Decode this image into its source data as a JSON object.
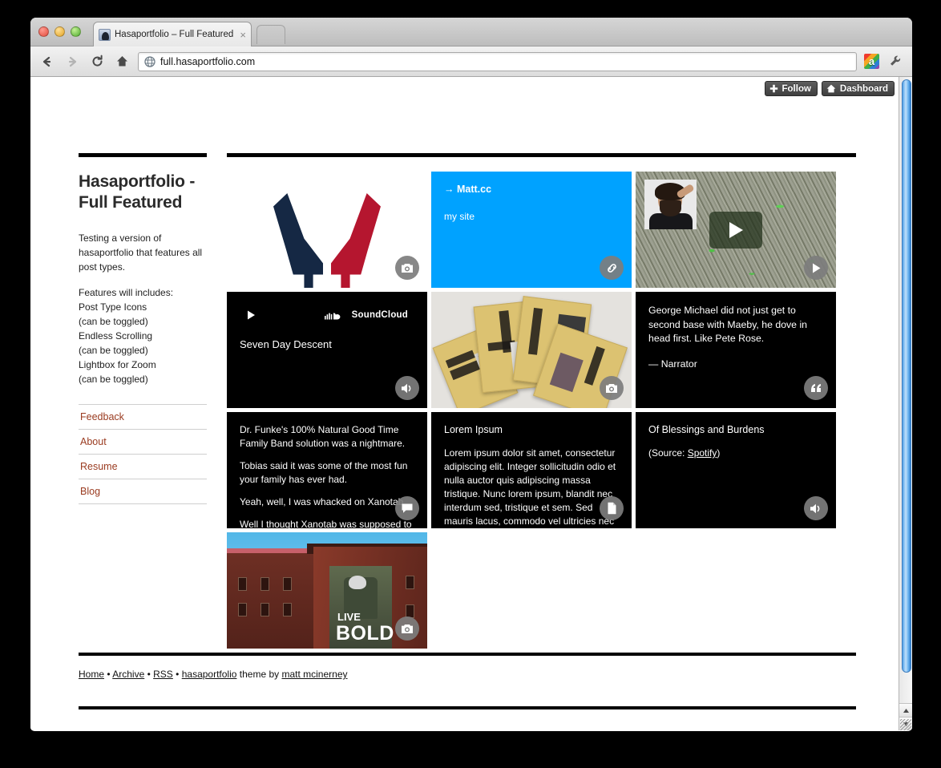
{
  "browser": {
    "tab_title": "Hasaportfolio – Full Featured",
    "tab_close": "×",
    "url": "full.hasaportfolio.com",
    "back_icon": "back-arrow-icon",
    "forward_icon": "forward-arrow-icon",
    "reload_icon": "reload-icon",
    "home_icon": "home-icon",
    "extension_icon": "rainbow-a-extension-icon",
    "menu_icon": "wrench-menu-icon"
  },
  "tumblr_bar": {
    "follow_label": "Follow",
    "dashboard_label": "Dashboard"
  },
  "sidebar": {
    "title": "Hasaportfolio - Full Featured",
    "description_1": "Testing a version of hasaportfolio that features all post types.",
    "description_2": "Features will includes:\nPost Type Icons\n(can be toggled)\nEndless Scrolling\n(can be toggled)\nLightbox for Zoom\n(can be toggled)",
    "nav": [
      {
        "label": "Feedback"
      },
      {
        "label": "About"
      },
      {
        "label": "Resume"
      },
      {
        "label": "Blog"
      }
    ]
  },
  "posts": [
    {
      "type": "photo",
      "name": "post-photo-horns",
      "badge": "camera-icon"
    },
    {
      "type": "link",
      "name": "post-link-mattcc",
      "title": "→ Matt.cc",
      "description": "my site",
      "badge": "link-icon",
      "bg": "#00a2ff"
    },
    {
      "type": "video",
      "name": "post-video",
      "badge": "play-icon"
    },
    {
      "type": "audio",
      "name": "post-audio-soundcloud",
      "service": "SoundCloud",
      "track": "Seven Day Descent",
      "badge": "speaker-icon"
    },
    {
      "type": "photo",
      "name": "post-photo-books",
      "badge": "camera-icon"
    },
    {
      "type": "quote",
      "name": "post-quote",
      "quote": "George Michael did not just get to second base with Maeby, he dove in head first. Like Pete Rose.",
      "source": "— Narrator",
      "badge": "quote-icon"
    },
    {
      "type": "chat",
      "name": "post-chat",
      "line_1": "Dr. Funke's 100% Natural Good Time Family Band solution was a nightmare.",
      "line_2": "Tobias said it was some of the most fun your family has ever had.",
      "line_3": "Yeah, well, I was whacked on Xanotab.",
      "line_4": "Well I thought Xanotab was supposed to",
      "badge": "chat-bubble-icon"
    },
    {
      "type": "text",
      "name": "post-text-lorem",
      "title": "Lorem Ipsum",
      "body": "Lorem ipsum dolor sit amet, consectetur adipiscing elit. Integer sollicitudin odio et nulla auctor quis adipiscing massa tristique. Nunc lorem ipsum, blandit nec interdum sed, tristique et sem. Sed mauris lacus, commodo vel ultricies nec",
      "badge": "document-icon"
    },
    {
      "type": "audio",
      "name": "post-audio-spotify",
      "title": "Of Blessings and Burdens",
      "source_prefix": "(Source: ",
      "source_link": "Spotify",
      "source_suffix": ")",
      "badge": "speaker-icon"
    },
    {
      "type": "photo",
      "name": "post-photo-livebold",
      "overlay_line_1": "LIVE",
      "overlay_line_2": "BOLD",
      "badge": "camera-icon"
    }
  ],
  "footer": {
    "home": "Home",
    "sep1": "•",
    "archive": "Archive",
    "sep2": "•",
    "rss": "RSS",
    "sep3": "•",
    "theme_name": "hasaportfolio",
    "theme_by": " theme by ",
    "author": "matt mcinerney"
  }
}
